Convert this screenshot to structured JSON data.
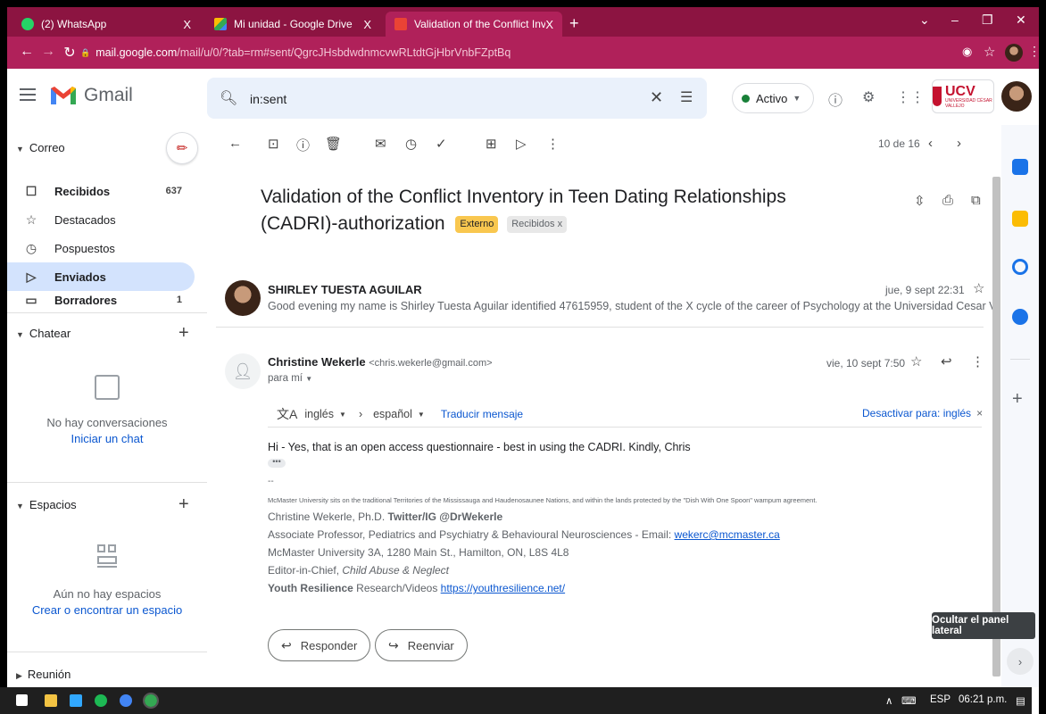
{
  "browser": {
    "tabs": [
      {
        "label": "(2) WhatsApp",
        "color": "#25d366"
      },
      {
        "label": "Mi unidad - Google Drive",
        "color": "#fbbc04"
      },
      {
        "label": "Validation of the Conflict Invento",
        "color": "#ea4335"
      }
    ],
    "url_host": "mail.google.com",
    "url_path": "/mail/u/0/?tab=rm#sent/QgrcJHsbdwdnmcvwRLtdtGjHbrVnbFZptBq",
    "close_glyph": "X",
    "newtab_glyph": "+",
    "lock_glyph": "🔒"
  },
  "gmail": {
    "logo_text": "Gmail",
    "search_query": "in:sent",
    "status_label": "Activo",
    "status_color": "#188038",
    "org_logo_text": "UCV",
    "org_logo_sub": "UNIVERSIDAD CÉSAR VALLEJO"
  },
  "nav": {
    "mail_section": "Correo",
    "items": [
      {
        "label": "Recibidos",
        "count": "637",
        "icon": "inbox-icon"
      },
      {
        "label": "Destacados",
        "count": "",
        "icon": "star-icon"
      },
      {
        "label": "Pospuestos",
        "count": "",
        "icon": "clock-icon"
      },
      {
        "label": "Enviados",
        "count": "",
        "icon": "send-icon"
      },
      {
        "label": "Borradores",
        "count": "1",
        "icon": "draft-icon"
      }
    ],
    "chat_section": "Chatear",
    "chat_empty": "No hay conversaciones",
    "chat_link": "Iniciar un chat",
    "spaces_section": "Espacios",
    "spaces_empty": "Aún no hay espacios",
    "spaces_link": "Crear o encontrar un espacio",
    "meet_section": "Reunión"
  },
  "toolbar": {
    "pager": "10 de 16"
  },
  "thread": {
    "subject": "Validation of the Conflict Inventory in Teen Dating Relationships (CADRI)-authorization",
    "label_external": "Externo",
    "label_inbox": "Recibidos",
    "label_close": "x",
    "messages": [
      {
        "sender": "SHIRLEY TUESTA AGUILAR",
        "date": "jue, 9 sept 22:31",
        "snippet": "Good evening my name is Shirley Tuesta Aguilar identified 47615959, student of the X cycle of the career of Psychology at the Universidad Cesar Vallejo Per..."
      },
      {
        "sender": "Christine Wekerle",
        "email": "<chris.wekerle@gmail.com>",
        "date": "vie, 10 sept 7:50",
        "to": "para mí",
        "body": "Hi - Yes, that is an open access questionnaire - best in using the CADRI.  Kindly, Chris",
        "dots": "•••",
        "sig_dashes": "--"
      }
    ],
    "translate": {
      "from": "inglés",
      "to": "español",
      "action": "Traducir mensaje",
      "disable": "Desactivar para: inglés"
    },
    "signature": {
      "land": "McMaster University sits on the traditional Territories of the Mississauga and Haudenosaunee Nations, and within the lands protected by the \"Dish With One Spoon\" wampum agreement.",
      "name": "Christine Wekerle, Ph.D.",
      "handle": "Twitter/IG @DrWekerle",
      "title": "Associate Professor, Pediatrics and Psychiatry & Behavioural Neurosciences - Email:",
      "email": "wekerc@mcmaster.ca",
      "address": "McMaster University 3A, 1280 Main St., Hamilton, ON, L8S 4L8",
      "editor_prefix": "Editor-in-Chief,",
      "editor_journal": "Child Abuse & Neglect",
      "yr_bold": "Youth Resilience",
      "yr_text": "Research/Videos",
      "yr_link": "https://youthresilience.net/"
    },
    "reply_label": "Responder",
    "forward_label": "Reenviar"
  },
  "tooltip": "Ocultar el panel lateral",
  "taskbar": {
    "lang": "ESP",
    "time": "06:21 p.m."
  },
  "colors": {
    "titlebar": "#8c1441",
    "addressbar": "#b0215a",
    "accent": "#0b57d0"
  }
}
